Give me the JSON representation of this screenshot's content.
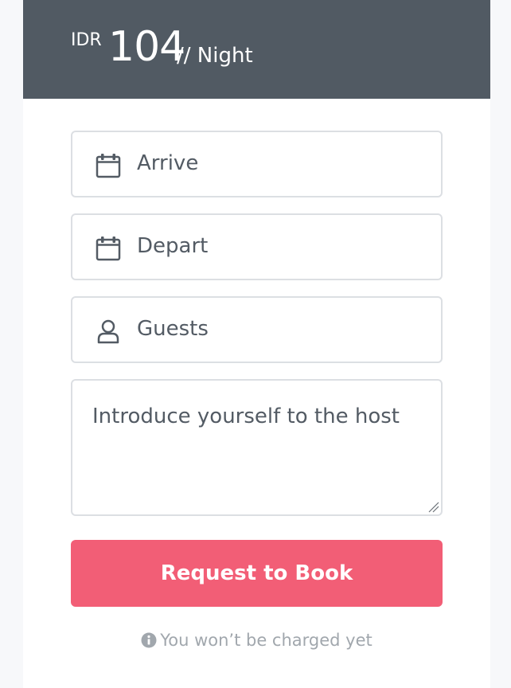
{
  "price": {
    "currency": "IDR",
    "amount": "104",
    "period": "// Night"
  },
  "form": {
    "arrive": {
      "label": "Arrive",
      "icon": "calendar-icon"
    },
    "depart": {
      "label": "Depart",
      "icon": "calendar-icon"
    },
    "guests": {
      "label": "Guests",
      "icon": "user-icon"
    },
    "message": {
      "placeholder": "Introduce yourself to the host"
    },
    "submit_label": "Request to Book",
    "note": "You won’t be charged yet",
    "note_icon": "info-icon"
  },
  "colors": {
    "header": "#515a63",
    "accent": "#f25e76",
    "text": "#535b64",
    "muted": "#a1a7ad",
    "border": "#dcdfe3"
  }
}
